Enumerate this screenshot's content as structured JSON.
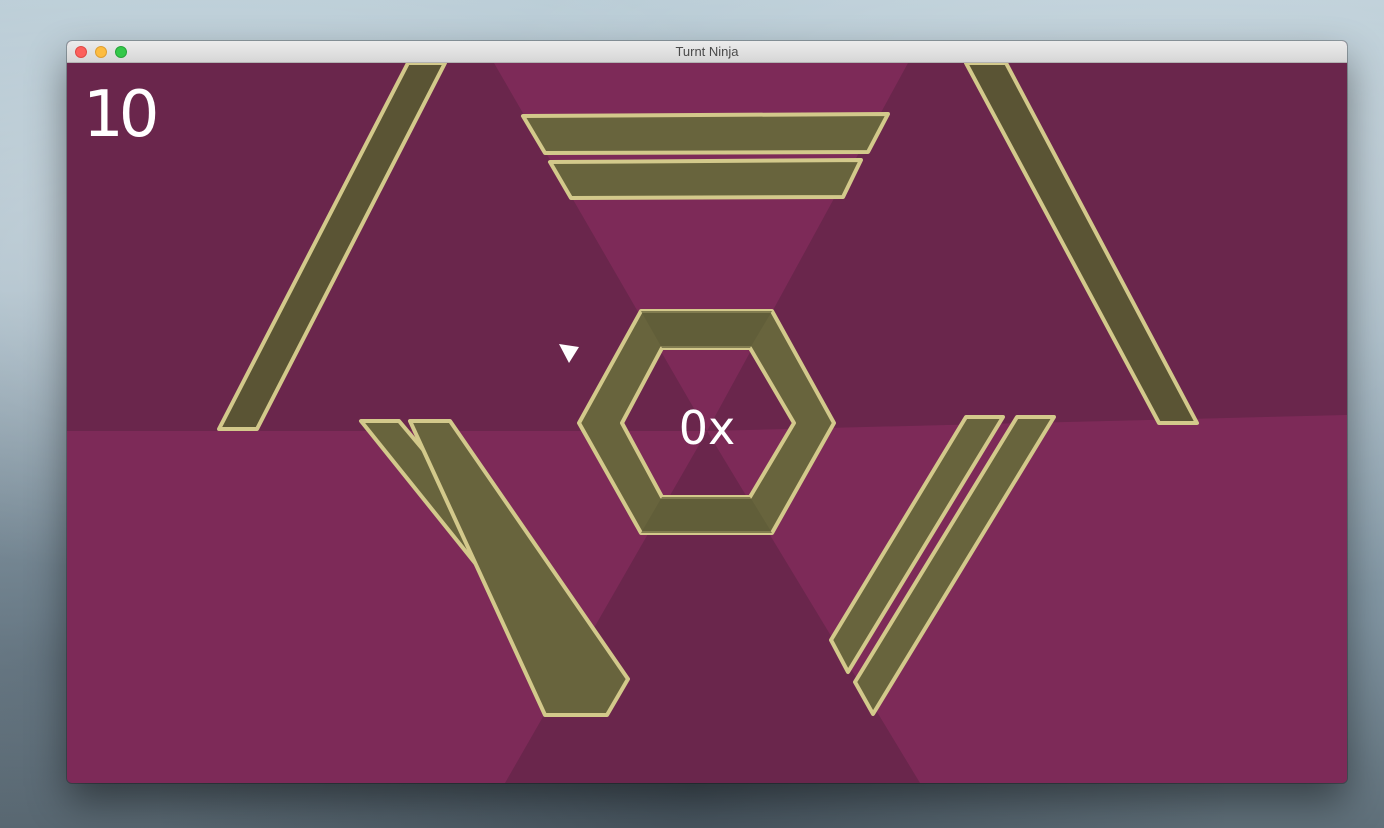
{
  "window": {
    "title": "Turnt Ninja"
  },
  "hud": {
    "score": "10",
    "multiplier": "0x"
  },
  "colors": {
    "background_light": "#7d2a58",
    "background_dark": "#6a264c",
    "wall_fill": "#5e5b38",
    "wall_outline": "#d3c98b",
    "player": "#ffffff"
  }
}
